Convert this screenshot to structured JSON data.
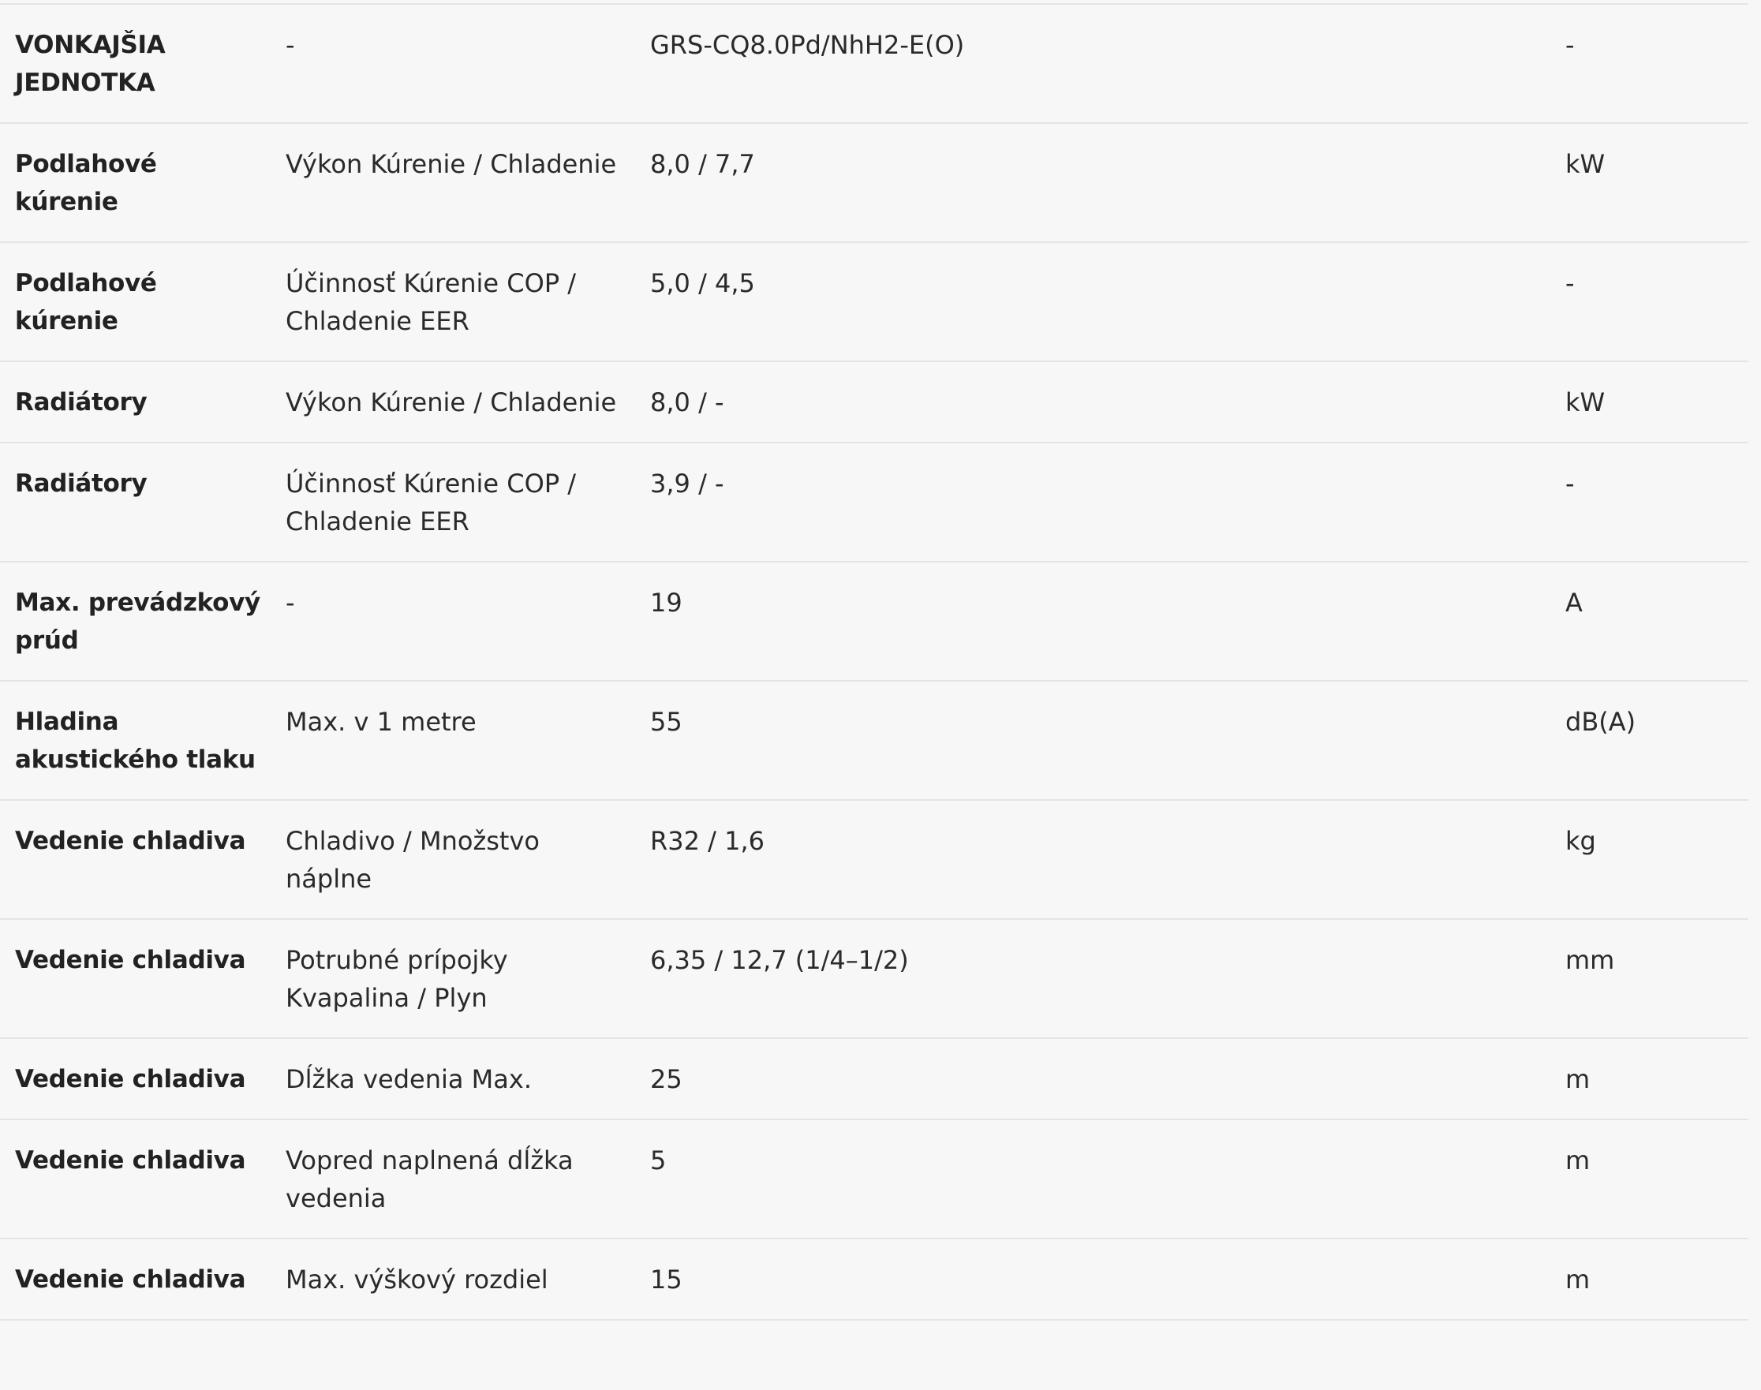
{
  "rows": [
    {
      "category": "VONKAJŠIA JEDNOTKA",
      "parameter": "-",
      "value": "GRS-CQ8.0Pd/NhH2-E(O)",
      "unit": "-"
    },
    {
      "category": "Podlahové kúrenie",
      "parameter": "Výkon Kúrenie / Chladenie",
      "value": "8,0 / 7,7",
      "unit": "kW"
    },
    {
      "category": "Podlahové kúrenie",
      "parameter": "Účinnosť Kúrenie COP / Chladenie EER",
      "value": "5,0 / 4,5",
      "unit": "-"
    },
    {
      "category": "Radiátory",
      "parameter": "Výkon Kúrenie / Chladenie",
      "value": "8,0 / -",
      "unit": "kW"
    },
    {
      "category": "Radiátory",
      "parameter": "Účinnosť Kúrenie COP / Chladenie EER",
      "value": "3,9 / -",
      "unit": "-"
    },
    {
      "category": "Max. prevádzkový prúd",
      "parameter": "-",
      "value": "19",
      "unit": "A"
    },
    {
      "category": "Hladina akustického tlaku",
      "parameter": "Max. v 1 metre",
      "value": "55",
      "unit": "dB(A)"
    },
    {
      "category": "Vedenie chladiva",
      "parameter": "Chladivo / Množstvo náplne",
      "value": "R32 / 1,6",
      "unit": "kg"
    },
    {
      "category": "Vedenie chladiva",
      "parameter": "Potrubné prípojky Kvapalina / Plyn",
      "value": "6,35 / 12,7 (1/4–1/2)",
      "unit": "mm"
    },
    {
      "category": "Vedenie chladiva",
      "parameter": "Dĺžka vedenia Max.",
      "value": "25",
      "unit": "m"
    },
    {
      "category": "Vedenie chladiva",
      "parameter": "Vopred naplnená dĺžka vedenia",
      "value": "5",
      "unit": "m"
    },
    {
      "category": "Vedenie chladiva",
      "parameter": "Max. výškový rozdiel",
      "value": "15",
      "unit": "m"
    }
  ]
}
